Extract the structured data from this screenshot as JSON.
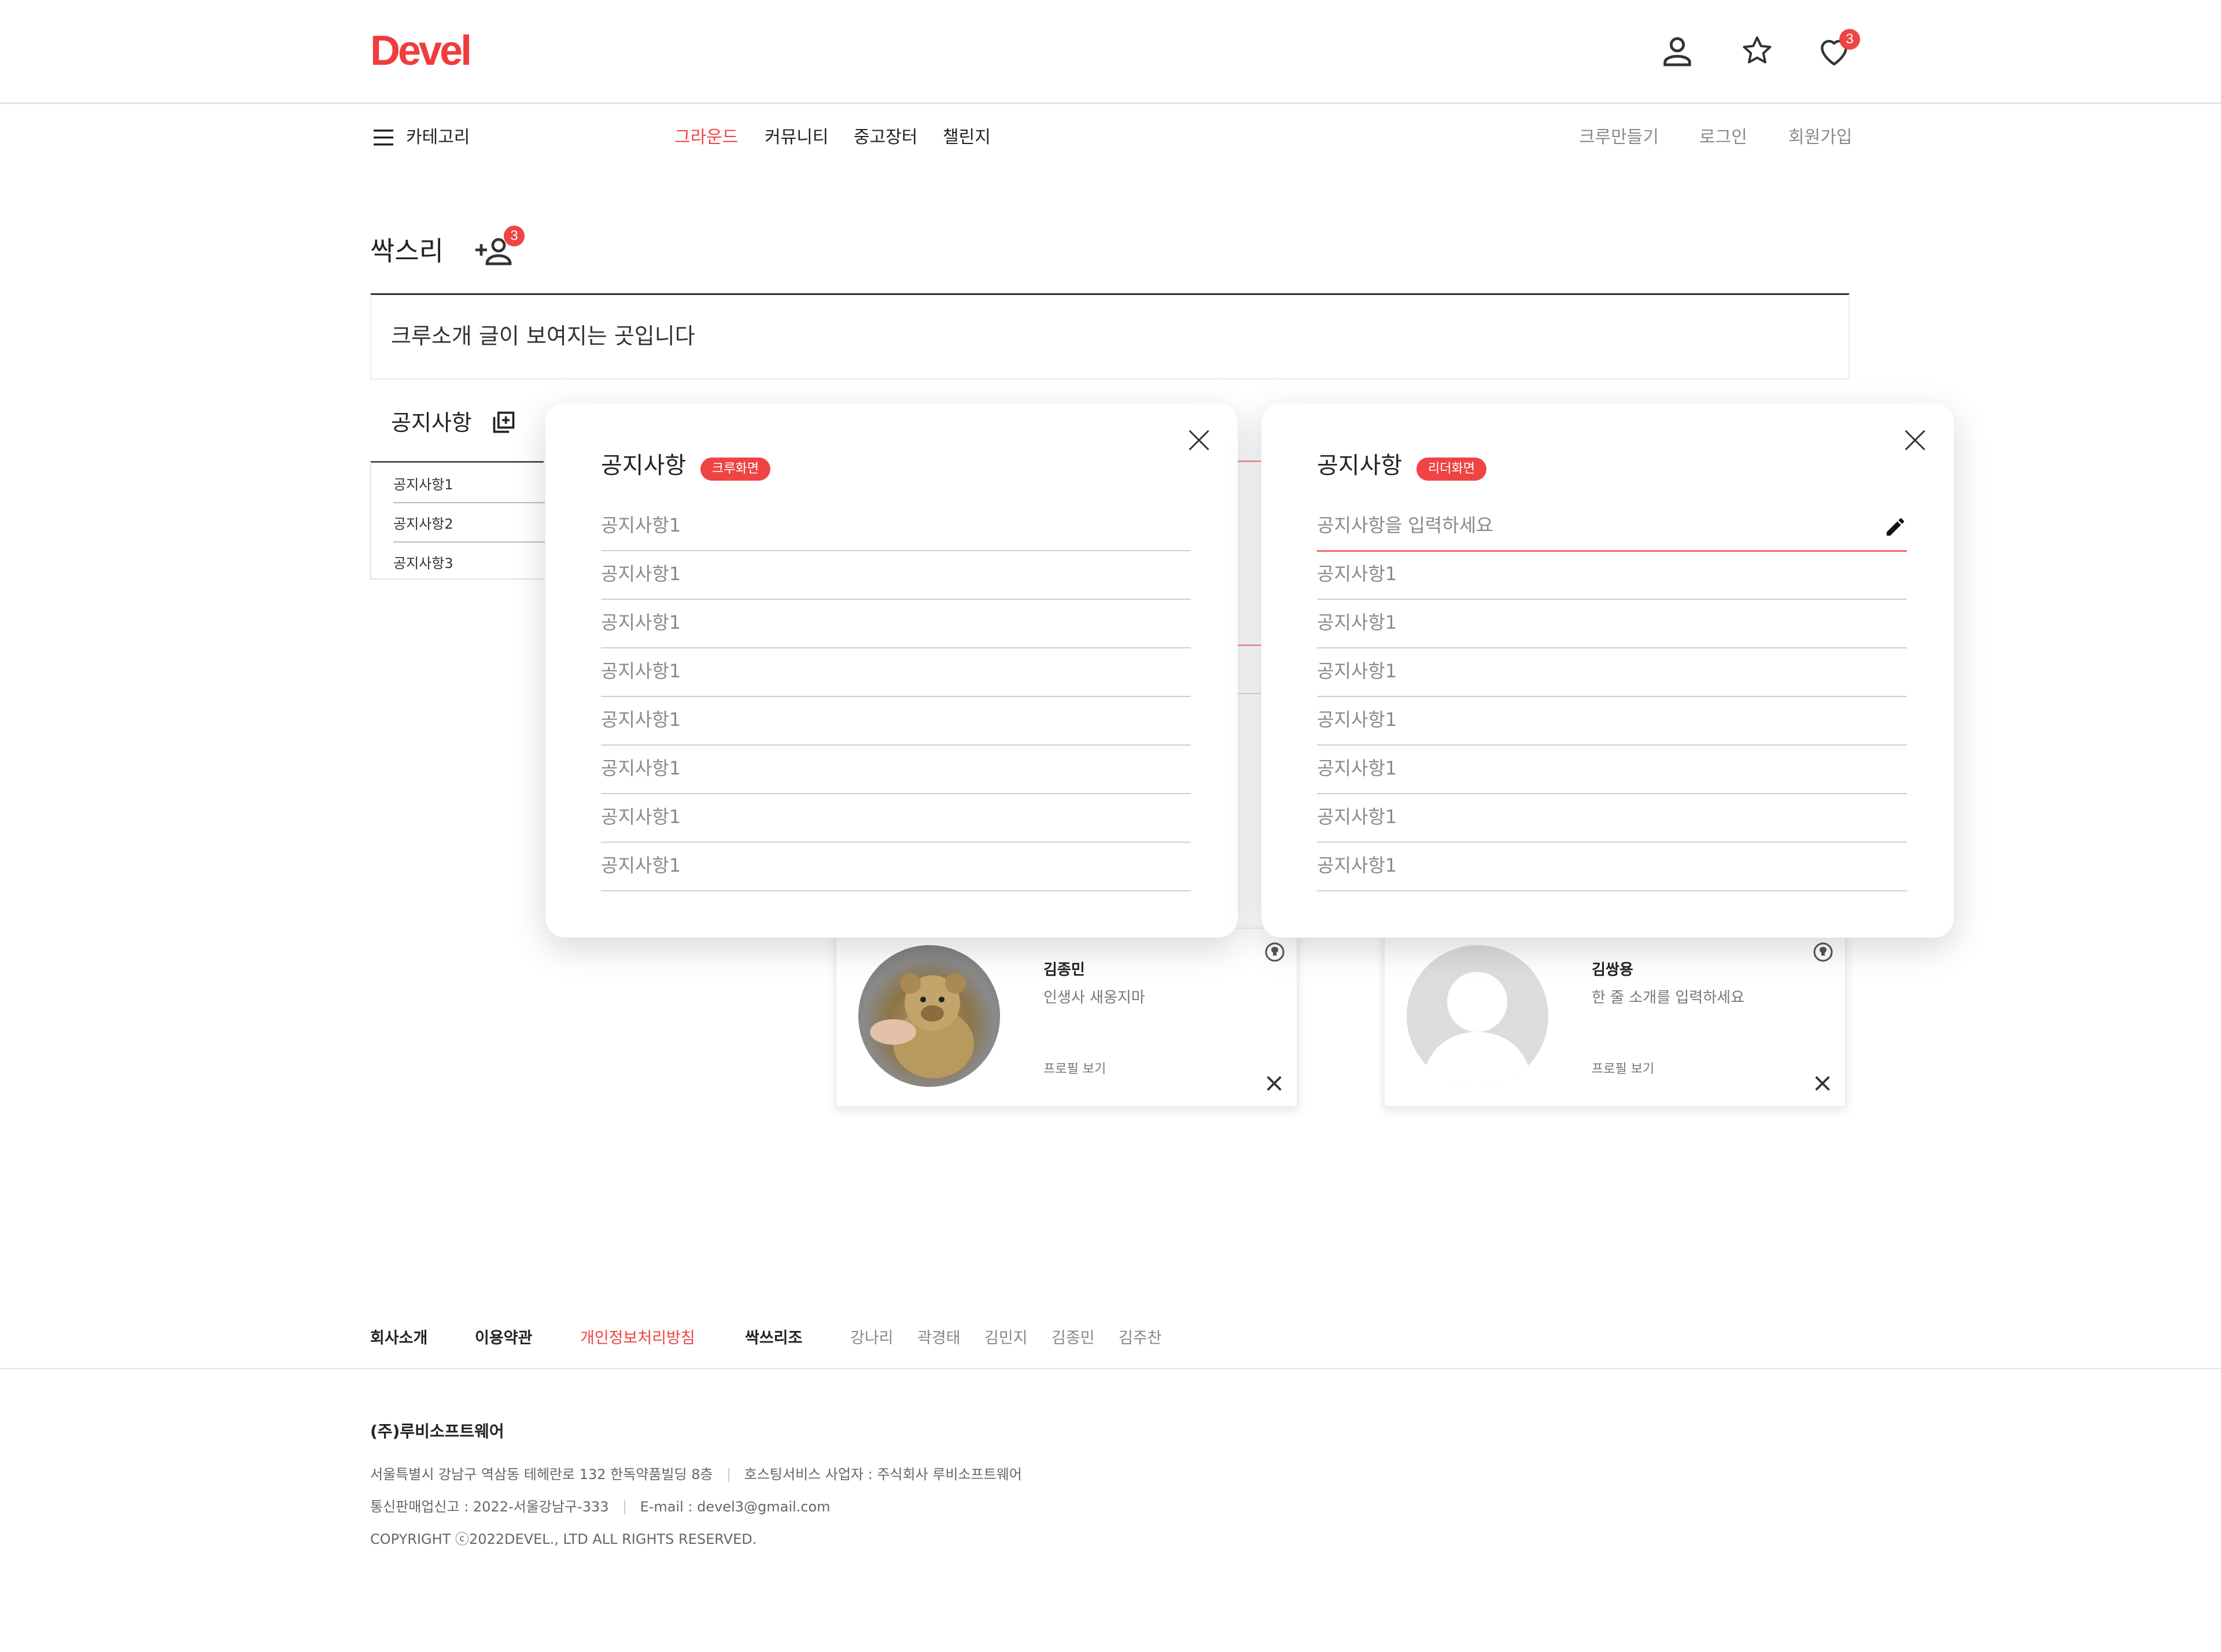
{
  "header": {
    "logo": "Devel",
    "heart_badge": "3"
  },
  "nav": {
    "category_label": "카테고리",
    "menu": [
      "그라운드",
      "커뮤니티",
      "중고장터",
      "챌린지"
    ],
    "right": [
      "크루만들기",
      "로그인",
      "회원가입"
    ]
  },
  "crew": {
    "title": "싹스리",
    "member_request_badge": "3",
    "intro": "크루소개 글이 보여지는 곳입니다",
    "notice_heading": "공지사항",
    "notices": [
      "공지사항1",
      "공지사항2",
      "공지사항3"
    ]
  },
  "members": [
    {
      "name": "김종민",
      "desc": "인생사 새옹지마",
      "link": "프로필 보기"
    },
    {
      "name": "김쌍용",
      "desc": "한 줄 소개를 입력하세요",
      "link": "프로필 보기"
    }
  ],
  "modal_crew": {
    "title": "공지사항",
    "tag": "크루화면",
    "items": [
      "공지사항1",
      "공지사항1",
      "공지사항1",
      "공지사항1",
      "공지사항1",
      "공지사항1",
      "공지사항1",
      "공지사항1"
    ]
  },
  "modal_leader": {
    "title": "공지사항",
    "tag": "리더화면",
    "input_placeholder": "공지사항을 입력하세요",
    "items": [
      "공지사항1",
      "공지사항1",
      "공지사항1",
      "공지사항1",
      "공지사항1",
      "공지사항1",
      "공지사항1"
    ]
  },
  "footer": {
    "links": [
      "회사소개",
      "이용약관",
      "개인정보처리방침"
    ],
    "team_label": "싹쓰리조",
    "team": [
      "강나리",
      "곽경태",
      "김민지",
      "김종민",
      "김주찬"
    ],
    "company": "(주)루비소프트웨어",
    "address": "서울특별시 강남구 역삼동 테헤란로 132 한독약품빌딩 8층",
    "hosting": "호스팅서비스 사업자 : 주식회사 루비소프트웨어",
    "registration": "통신판매업신고 : 2022-서울강남구-333",
    "email": "E-mail : devel3@gmail.com",
    "copyright": "COPYRIGHT ⓒ2022DEVEL., LTD ALL RIGHTS RESERVED."
  },
  "colors": {
    "brand_red": "#ef4444",
    "text": "#222222",
    "muted": "#8a8a8a"
  }
}
